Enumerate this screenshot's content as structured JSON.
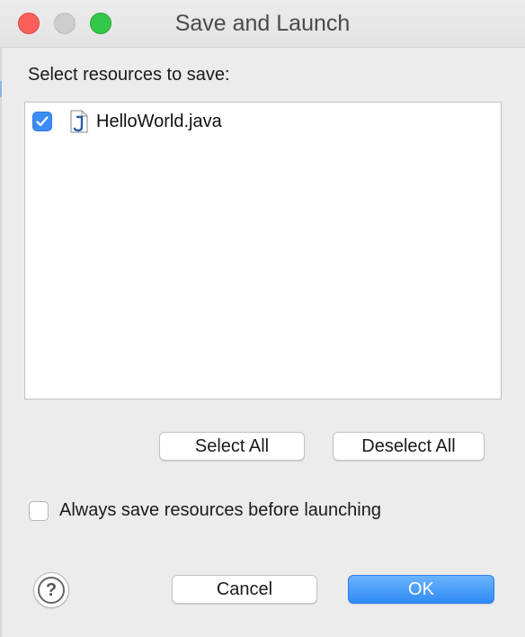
{
  "window": {
    "title": "Save and Launch",
    "controls": {
      "close": "close",
      "minimize": "minimize",
      "zoom": "zoom"
    }
  },
  "prompt": "Select resources to save:",
  "resources": [
    {
      "name": "HelloWorld.java",
      "checked": true,
      "icon": "java-file-icon"
    }
  ],
  "buttons": {
    "select_all": "Select All",
    "deselect_all": "Deselect All",
    "cancel": "Cancel",
    "ok": "OK"
  },
  "always_save": {
    "label": "Always save resources before launching",
    "checked": false
  },
  "help": {
    "glyph": "?"
  },
  "colors": {
    "accent": "#3b8cf5",
    "close": "#fc605b",
    "zoom": "#34c84a",
    "ok_button": "#2e8bf6"
  }
}
